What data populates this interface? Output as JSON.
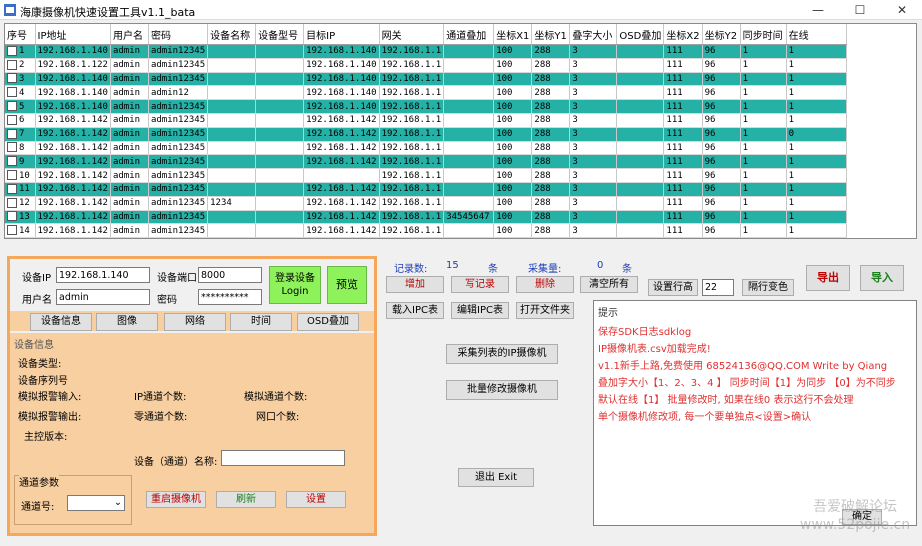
{
  "window": {
    "title": "海康摄像机快速设置工具v1.1_bata",
    "minimize": "—",
    "maximize": "☐",
    "close": "✕"
  },
  "grid": {
    "columns": [
      "序号",
      "IP地址",
      "用户名",
      "密码",
      "设备名称",
      "设备型号",
      "目标IP",
      "网关",
      "通道叠加",
      "坐标X1",
      "坐标Y1",
      "叠字大小",
      "OSD叠加",
      "坐标X2",
      "坐标Y2",
      "同步时间",
      "在线"
    ],
    "rows": [
      [
        "1",
        "192.168.1.140",
        "admin",
        "admin12345",
        "",
        "",
        "192.168.1.140",
        "192.168.1.1",
        "",
        "100",
        "288",
        "3",
        "",
        "111",
        "96",
        "1",
        "1"
      ],
      [
        "2",
        "192.168.1.122",
        "admin",
        "admin12345",
        "",
        "",
        "192.168.1.140",
        "192.168.1.1",
        "",
        "100",
        "288",
        "3",
        "",
        "111",
        "96",
        "1",
        "1"
      ],
      [
        "3",
        "192.168.1.140",
        "admin",
        "admin12345",
        "",
        "",
        "192.168.1.140",
        "192.168.1.1",
        "",
        "100",
        "288",
        "3",
        "",
        "111",
        "96",
        "1",
        "1"
      ],
      [
        "4",
        "192.168.1.140",
        "admin",
        "admin12",
        "",
        "",
        "192.168.1.140",
        "192.168.1.1",
        "",
        "100",
        "288",
        "3",
        "",
        "111",
        "96",
        "1",
        "1"
      ],
      [
        "5",
        "192.168.1.140",
        "admin",
        "admin12345",
        "",
        "",
        "192.168.1.140",
        "192.168.1.1",
        "",
        "100",
        "288",
        "3",
        "",
        "111",
        "96",
        "1",
        "1"
      ],
      [
        "6",
        "192.168.1.142",
        "admin",
        "admin12345",
        "",
        "",
        "192.168.1.142",
        "192.168.1.1",
        "",
        "100",
        "288",
        "3",
        "",
        "111",
        "96",
        "1",
        "1"
      ],
      [
        "7",
        "192.168.1.142",
        "admin",
        "admin12345",
        "",
        "",
        "192.168.1.142",
        "192.168.1.1",
        "",
        "100",
        "288",
        "3",
        "",
        "111",
        "96",
        "1",
        "0"
      ],
      [
        "8",
        "192.168.1.142",
        "admin",
        "admin12345",
        "",
        "",
        "192.168.1.142",
        "192.168.1.1",
        "",
        "100",
        "288",
        "3",
        "",
        "111",
        "96",
        "1",
        "1"
      ],
      [
        "9",
        "192.168.1.142",
        "admin",
        "admin12345",
        "",
        "",
        "192.168.1.142",
        "192.168.1.1",
        "",
        "100",
        "288",
        "3",
        "",
        "111",
        "96",
        "1",
        "1"
      ],
      [
        "10",
        "192.168.1.142",
        "admin",
        "admin12345",
        "",
        "",
        "",
        "192.168.1.1",
        "",
        "100",
        "288",
        "3",
        "",
        "111",
        "96",
        "1",
        "1"
      ],
      [
        "11",
        "192.168.1.142",
        "admin",
        "admin12345",
        "",
        "",
        "192.168.1.142",
        "192.168.1.1",
        "",
        "100",
        "288",
        "3",
        "",
        "111",
        "96",
        "1",
        "1"
      ],
      [
        "12",
        "192.168.1.142",
        "admin",
        "admin12345",
        "1234",
        "",
        "192.168.1.142",
        "192.168.1.1",
        "",
        "100",
        "288",
        "3",
        "",
        "111",
        "96",
        "1",
        "1"
      ],
      [
        "13",
        "192.168.1.142",
        "admin",
        "admin12345",
        "",
        "",
        "192.168.1.142",
        "192.168.1.1",
        "34545647",
        "100",
        "288",
        "3",
        "",
        "111",
        "96",
        "1",
        "1"
      ],
      [
        "14",
        "192.168.1.142",
        "admin",
        "admin12345",
        "",
        "",
        "192.168.1.142",
        "192.168.1.1",
        "",
        "100",
        "288",
        "3",
        "",
        "111",
        "96",
        "1",
        "1"
      ],
      [
        "15",
        "192.168.1.142",
        "admin",
        "admin12345",
        "",
        "",
        "192.168.1.142",
        "192.168.1.1",
        "",
        "100",
        "288",
        "3",
        "",
        "111",
        "96",
        "1",
        "1"
      ]
    ]
  },
  "login": {
    "ip_label": "设备IP",
    "ip_value": "192.168.1.140",
    "port_label": "设备端口",
    "port_value": "8000",
    "user_label": "用户名",
    "user_value": "admin",
    "pwd_label": "密码",
    "pwd_value": "**********",
    "login_button": "登录设备\nLogin",
    "preview_button": "预览"
  },
  "tabs": [
    "设备信息",
    "图像",
    "网络",
    "时间",
    "OSD叠加"
  ],
  "device_info": {
    "group_title": "设备信息",
    "type_label": "设备类型:",
    "serial_label": "设备序列号",
    "analog_alarm_in": "模拟报警输入:",
    "ip_channels": "IP通道个数:",
    "analog_channels": "模拟通道个数:",
    "analog_alarm_out": "模拟报警输出:",
    "zero_channels": "零通道个数:",
    "net_ports": "网口个数:",
    "firmware": "主控版本:",
    "channel_name_label": "设备（通道）名称:",
    "channel_group": "通道参数",
    "channel_no_label": "通道号:",
    "reboot_button": "重启摄像机",
    "refresh_button": "刷新",
    "set_button": "设置"
  },
  "stats": {
    "records_label": "记录数:",
    "records_value": "15",
    "unit1": "条",
    "collect_label": "采集量:",
    "collect_value": "0",
    "unit2": "条"
  },
  "actions": {
    "add": "增加",
    "write": "写记录",
    "delete": "删除",
    "clear": "清空所有",
    "row_height": "设置行高",
    "row_height_value": "22",
    "alt_color": "隔行变色",
    "export": "导出",
    "import": "导入",
    "load_ipc": "载入IPC表",
    "edit_ipc": "编辑IPC表",
    "open_file": "打开文件夹",
    "collect_list": "采集列表的IP摄像机",
    "batch_modify": "批量修改摄像机",
    "exit": "退出 Exit"
  },
  "log": {
    "title": "提示",
    "lines": [
      "保存SDK日志sdklog",
      "IP摄像机表.csv加载完成!",
      "v1.1新手上路,免费使用 68524136@QQ.COM          Write by Qiang",
      "叠加字大小【1、2、3、4 】 同步时间【1】为同步    【0】为不同步",
      "默认在线【1】    批量修改时, 如果在线0 表示这行不会处理",
      "单个摄像机修改项, 每一个要单独点<设置>确认"
    ]
  },
  "watermark": "吾爱破解论坛\nwww.52pojie.cn",
  "bottom_button": "确定"
}
